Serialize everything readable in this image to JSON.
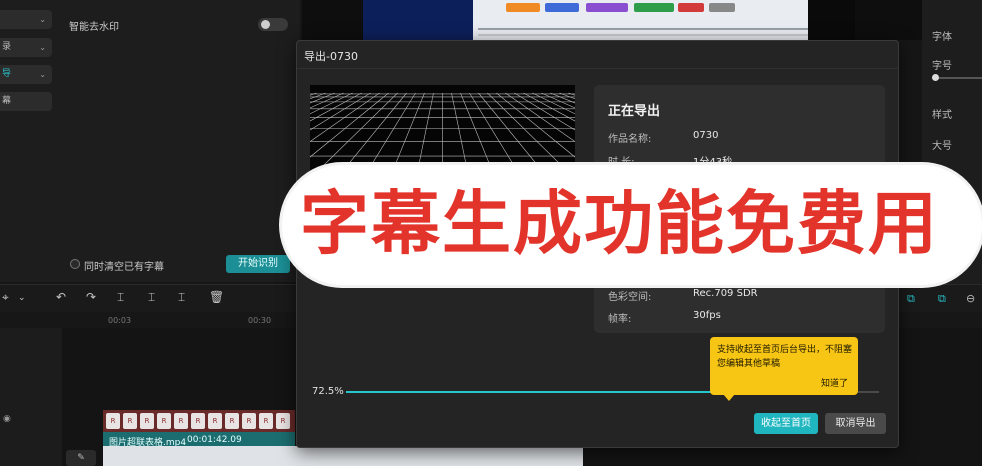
{
  "left_panel": {
    "options": [
      {
        "label": "",
        "accent": false
      },
      {
        "label": "录",
        "accent": false
      },
      {
        "label": "导",
        "accent": true
      },
      {
        "label": "幕",
        "accent": false
      }
    ],
    "watermark_label": "智能去水印",
    "clear_label": "同时清空已有字幕",
    "start_button": "开始识别"
  },
  "right_panel": {
    "labels": [
      "字体",
      "字号",
      "样式",
      "大号"
    ]
  },
  "timeline": {
    "ticks": [
      "00:03",
      "00:30"
    ],
    "clip_name": "图片超联表格.mp4",
    "clip_time": "00:01:42.09",
    "frame_glyph": "R"
  },
  "dialog": {
    "title": "导出-0730",
    "status_title": "正在导出",
    "info": [
      {
        "key": "作品名称:",
        "value": "0730"
      },
      {
        "key": "时 长:",
        "value": "1分43秒"
      },
      {
        "key": "色彩空间:",
        "value": "Rec.709 SDR"
      },
      {
        "key": "帧率:",
        "value": "30fps"
      }
    ],
    "progress_text": "72.5%",
    "progress": 0.725,
    "minimize_button": "收起至首页",
    "cancel_button": "取消导出"
  },
  "tooltip": {
    "text": "支持收起至首页后台导出，不阻塞您编辑其他草稿",
    "confirm": "知道了"
  },
  "overlay": {
    "text": "字幕生成功能免费用"
  },
  "colors": {
    "accent": "#26c6cf",
    "tooltip": "#f7c514",
    "banner_text": "#e2342b"
  },
  "icons": [
    "undo-icon",
    "redo-icon",
    "split-icon",
    "split-left-icon",
    "split-right-icon",
    "delete-icon",
    "select-icon",
    "eye-icon",
    "edit-icon"
  ]
}
